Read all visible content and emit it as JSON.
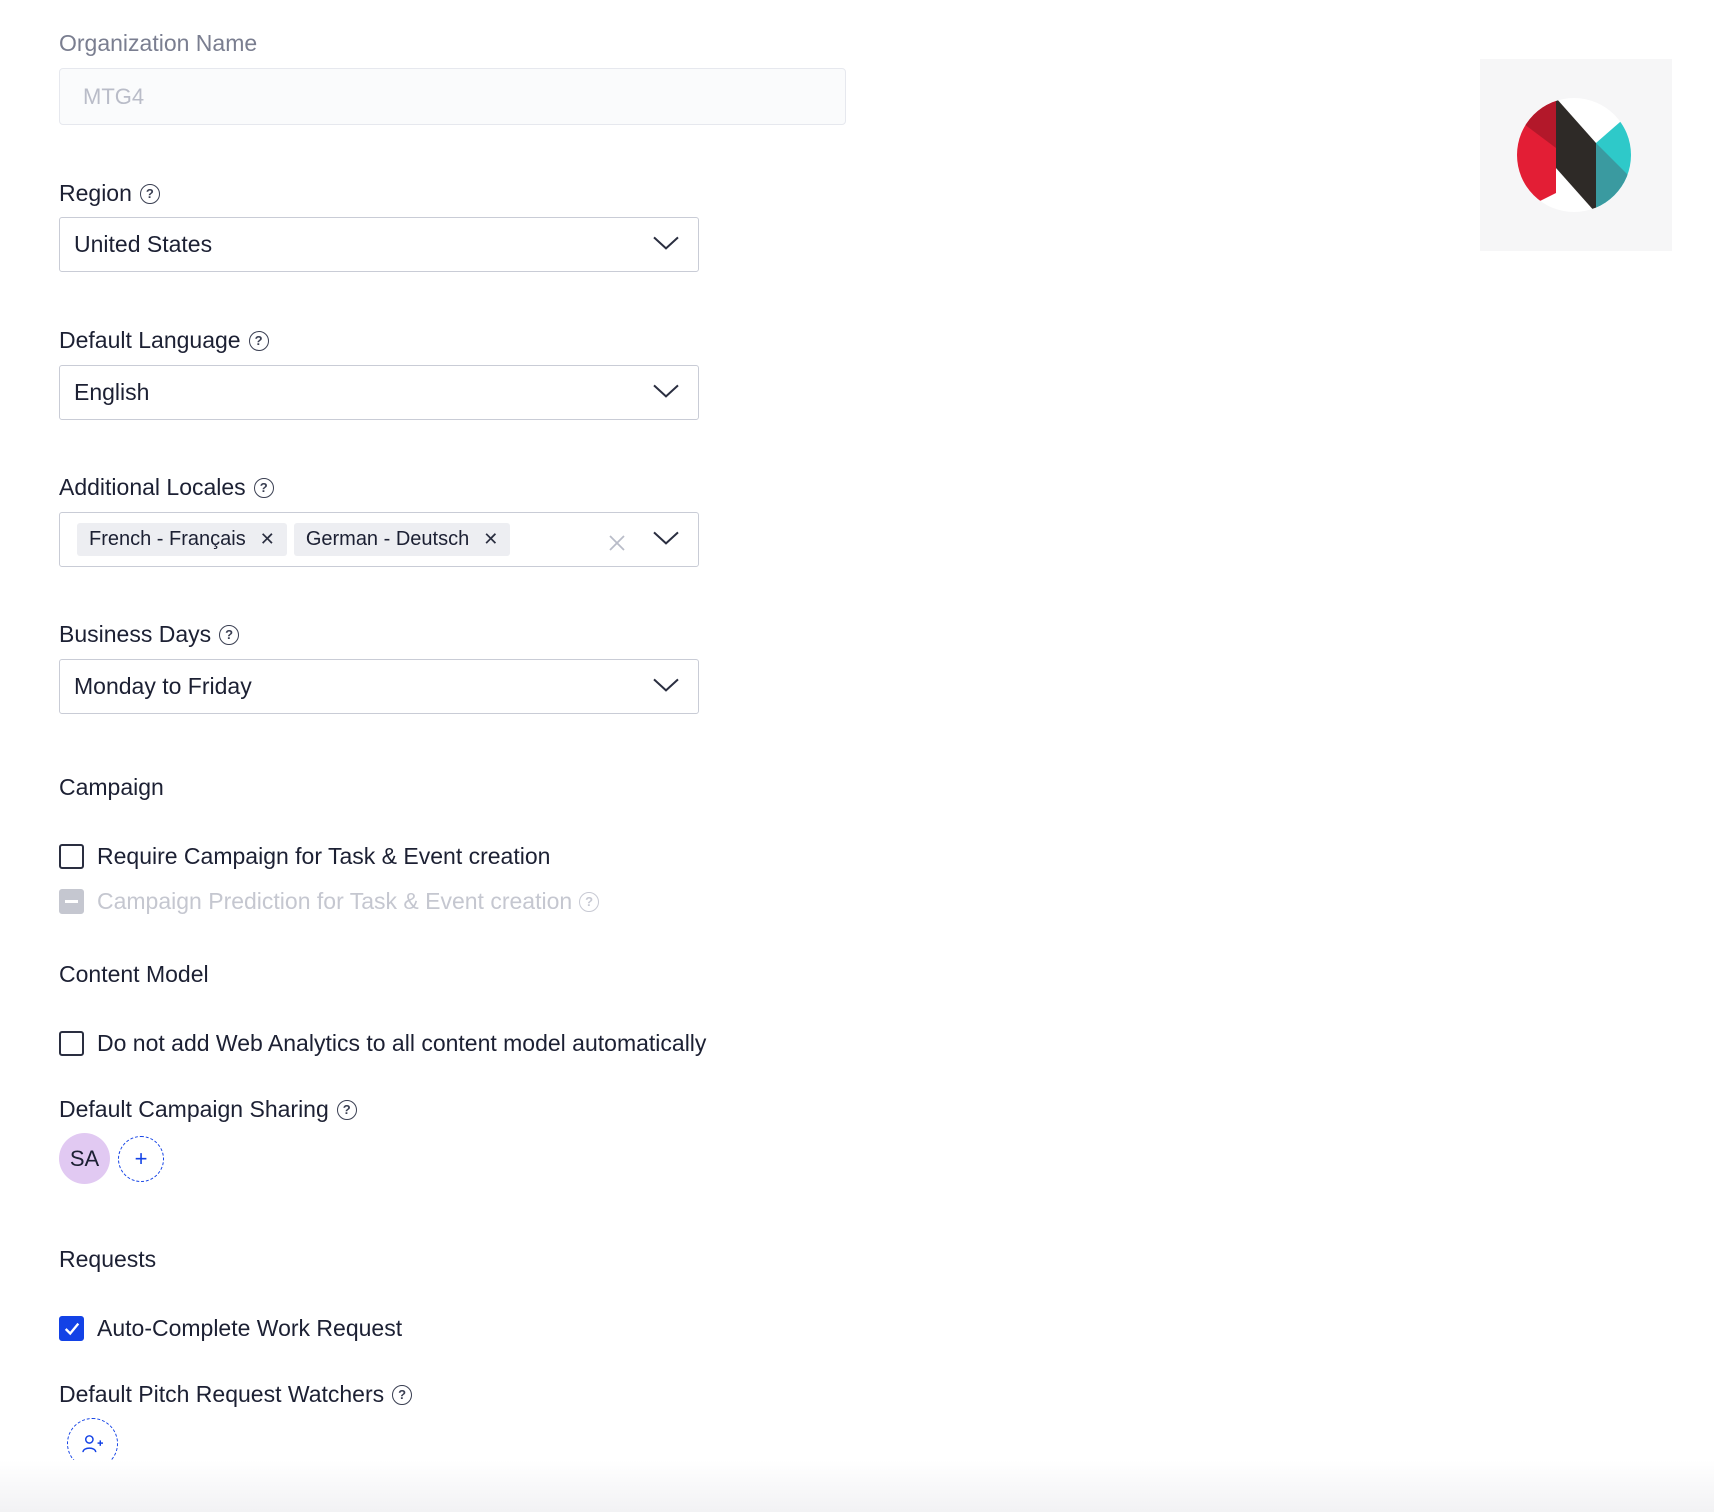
{
  "org": {
    "label": "Organization Name",
    "value": "MTG4"
  },
  "region": {
    "label": "Region",
    "value": "United States"
  },
  "language": {
    "label": "Default Language",
    "value": "English"
  },
  "locales": {
    "label": "Additional Locales",
    "chips": [
      "French - Français",
      "German - Deutsch"
    ]
  },
  "business_days": {
    "label": "Business Days",
    "value": "Monday to Friday"
  },
  "campaign": {
    "title": "Campaign",
    "require_label": "Require Campaign for Task & Event creation",
    "require_checked": false,
    "prediction_label": "Campaign Prediction for Task & Event creation",
    "prediction_state": "indeterminate-disabled"
  },
  "content_model": {
    "title": "Content Model",
    "web_analytics_label": "Do not add Web Analytics to all content model automatically",
    "web_analytics_checked": false
  },
  "campaign_sharing": {
    "label": "Default Campaign Sharing",
    "avatar_initials": "SA"
  },
  "requests": {
    "title": "Requests",
    "auto_complete_label": "Auto-Complete Work Request",
    "auto_complete_checked": true
  },
  "pitch_watchers": {
    "label": "Default Pitch Request Watchers"
  },
  "colors": {
    "accent": "#1342e6",
    "avatar_bg": "#e1c9f2",
    "logo_red": "#e31e35",
    "logo_dark": "#2e2a27",
    "logo_teal": "#2ec9c9"
  }
}
